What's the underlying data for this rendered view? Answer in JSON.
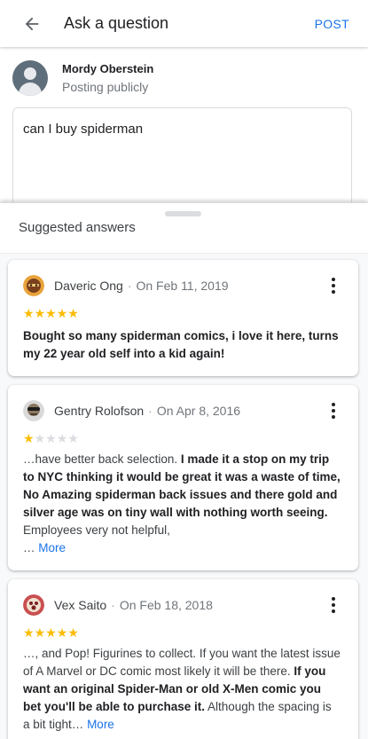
{
  "header": {
    "title": "Ask a question",
    "post_label": "POST"
  },
  "poster": {
    "name": "Mordy Oberstein",
    "visibility": "Posting publicly"
  },
  "question": {
    "value": "can I buy spiderman"
  },
  "sheet": {
    "title": "Suggested answers"
  },
  "colors": {
    "accent": "#1a73e8",
    "star": "#fbbc04",
    "star_empty": "#dadce0"
  },
  "reviews": [
    {
      "name": "Daveric Ong",
      "sep": "·",
      "date": "On Feb 11, 2019",
      "rating": 5,
      "t1": "Bought so many spiderman comics, i love it here, turns my 22 year old self into a kid again!"
    },
    {
      "name": "Gentry Rolofson",
      "sep": "·",
      "date": "On Apr 8, 2016",
      "rating": 1,
      "t1": "…have better back selection. ",
      "t2": "I made it a stop on my trip to NYC thinking it would be great it was a waste of time, No Amazing spiderman back issues and there gold and silver age was on tiny wall with nothing worth seeing.",
      "t3": " Employees very not helpful,",
      "ellipsis": "…",
      "more": "More"
    },
    {
      "name": "Vex Saito",
      "sep": "·",
      "date": "On Feb 18, 2018",
      "rating": 5,
      "t1": "…, and Pop! Figurines to collect. If you want the latest issue of A Marvel or DC comic most likely it will be there. ",
      "t2": "If you want an original Spider-Man or old X-Men comic you bet you'll be able to purchase it.",
      "t3": " Although the spacing is a bit tight…",
      "more": "More"
    }
  ]
}
